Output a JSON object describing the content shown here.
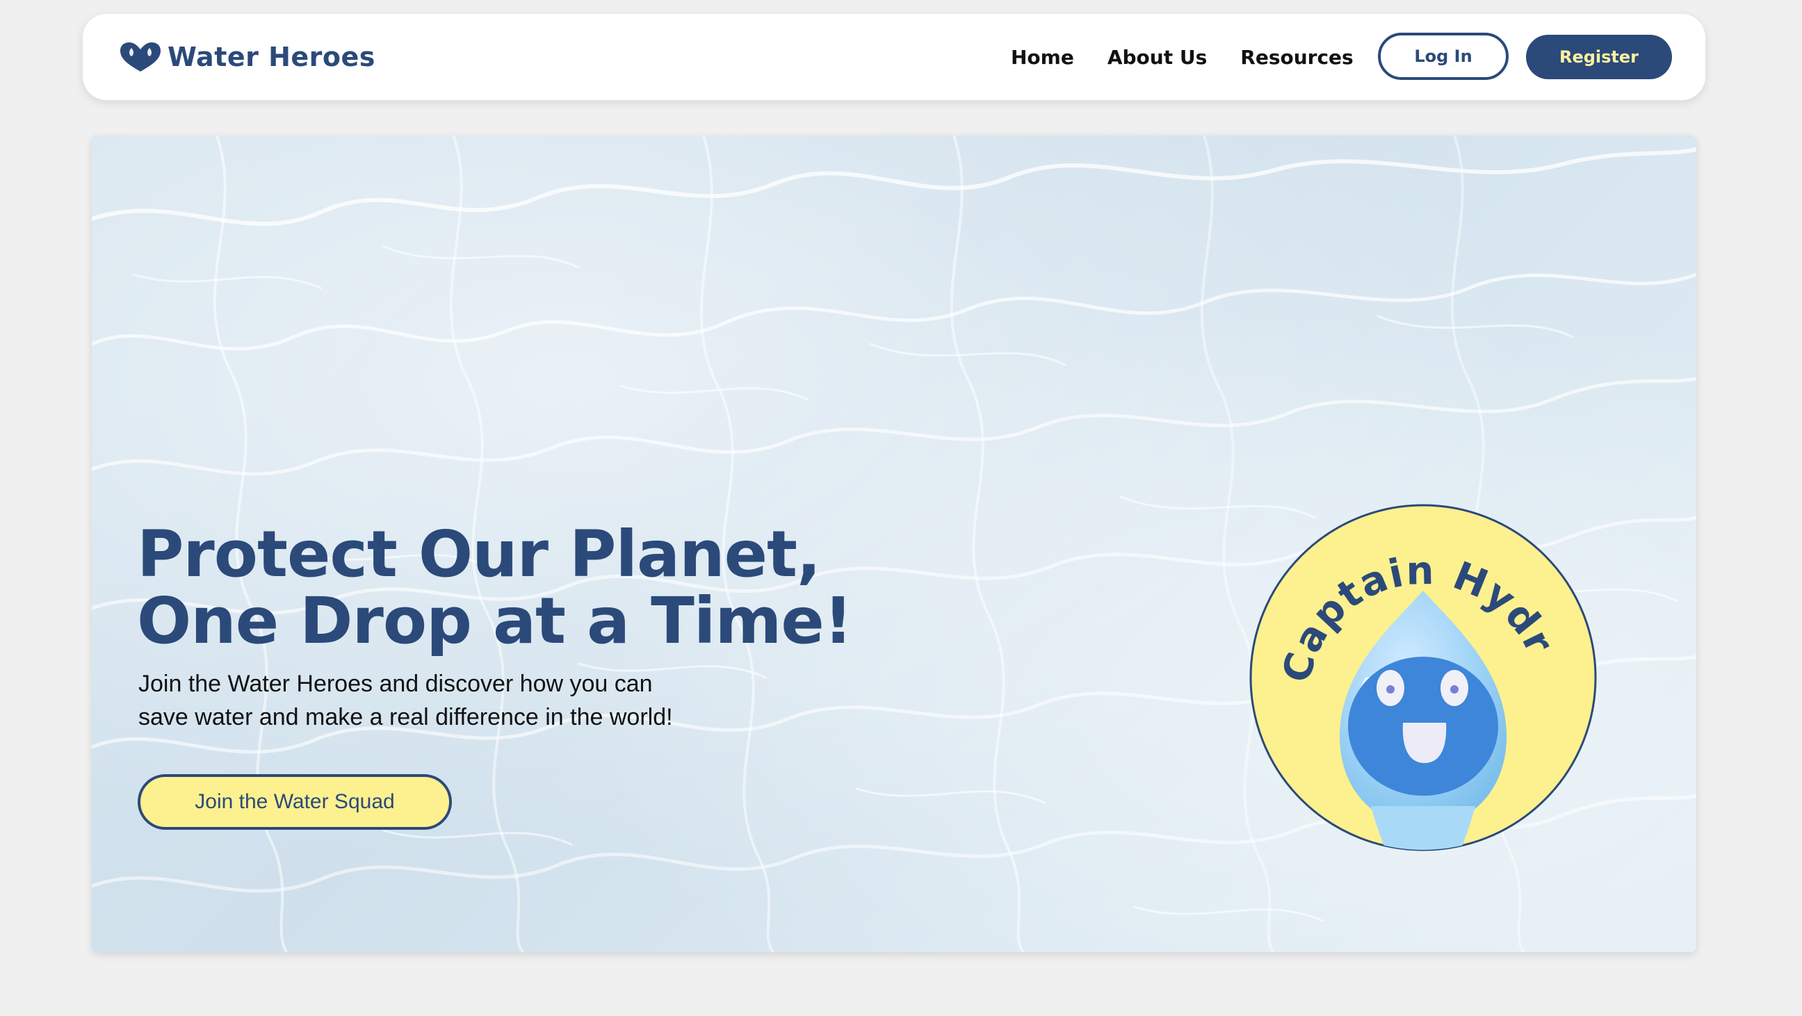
{
  "colors": {
    "brand_navy": "#2b4a7a",
    "accent_yellow": "#fdf08f",
    "page_background": "#f0f0f0",
    "water_light": "#d6e5ef"
  },
  "header": {
    "logo_icon": "heart-drop-icon",
    "logo_text": "Water Heroes",
    "nav": [
      "Home",
      "About Us",
      "Resources"
    ],
    "login_label": "Log In",
    "register_label": "Register"
  },
  "hero": {
    "background": "water-ripple-image",
    "title_line1": "Protect Our Planet,",
    "title_line2": "One Drop at a Time!",
    "subtitle_line1": "Join the Water Heroes and discover how you can",
    "subtitle_line2": "save water and make a real difference in the world!",
    "cta_label": "Join the Water Squad",
    "mascot": {
      "name": "Captain Hydro",
      "icon": "water-drop-mascot-icon"
    }
  }
}
